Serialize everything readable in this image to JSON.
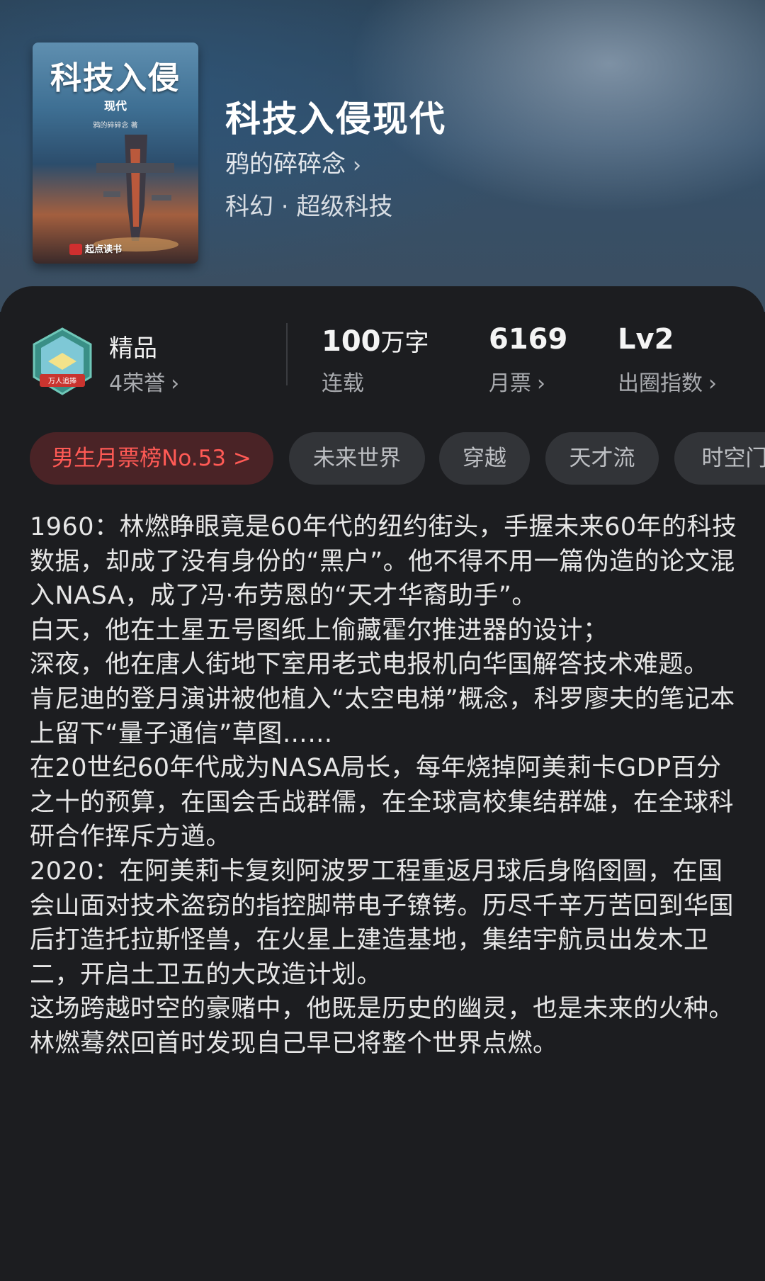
{
  "book": {
    "cover_title": "科技入侵",
    "cover_subtitle": "现代",
    "cover_author": "鸦的碎碎念 著",
    "cover_publisher": "起点读书",
    "title": "科技入侵现代",
    "author": "鸦的碎碎念",
    "genre": "科幻 · 超级科技"
  },
  "stats": {
    "quality": {
      "label": "精品",
      "honors": "4荣誉",
      "badge_text": "万人追捧"
    },
    "words": {
      "num": "100",
      "unit": "万字",
      "label": "连载"
    },
    "monthly_votes": {
      "num": "6169",
      "label": "月票"
    },
    "circle_index": {
      "num": "Lv2",
      "label": "出圈指数"
    }
  },
  "tags": [
    "男生月票榜No.53 >",
    "未来世界",
    "穿越",
    "天才流",
    "时空门"
  ],
  "description": [
    "1960：林燃睁眼竟是60年代的纽约街头，手握未来60年的科技数据，却成了没有身份的“黑户”。他不得不用一篇伪造的论文混入NASA，成了冯·布劳恩的“天才华裔助手”。",
    "白天，他在土星五号图纸上偷藏霍尔推进器的设计；",
    "深夜，他在唐人街地下室用老式电报机向华国解答技术难题。",
    "肯尼迪的登月演讲被他植入“太空电梯”概念，科罗廖夫的笔记本上留下“量子通信”草图……",
    "在20世纪60年代成为NASA局长，每年烧掉阿美莉卡GDP百分之十的预算，在国会舌战群儒，在全球高校集结群雄，在全球科研合作挥斥方遒。",
    "2020：在阿美莉卡复刻阿波罗工程重返月球后身陷囹圄，在国会山面对技术盗窃的指控脚带电子镣铐。历尽千辛万苦回到华国后打造托拉斯怪兽，在火星上建造基地，集结宇航员出发木卫二，开启土卫五的大改造计划。",
    "这场跨越时空的豪赌中，他既是历史的幽灵，也是未来的火种。",
    "林燃蓦然回首时发现自己早已将整个世界点燃。"
  ]
}
